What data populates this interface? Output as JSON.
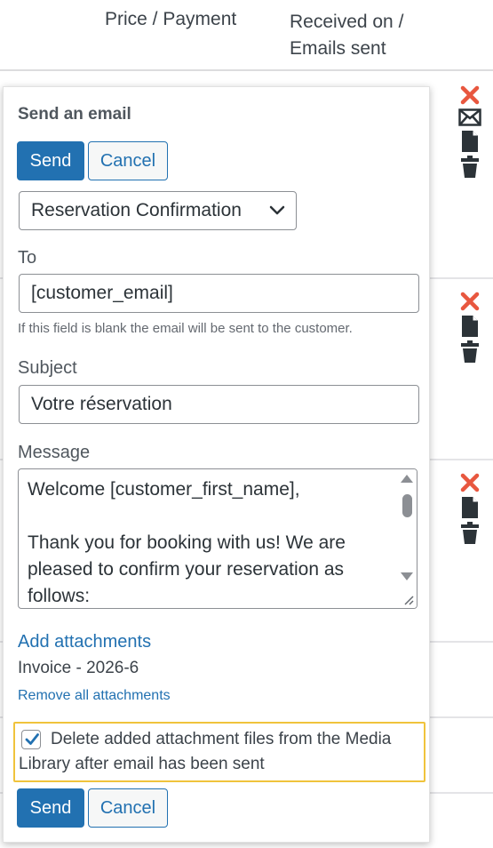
{
  "table": {
    "col_price": "Price / Payment",
    "col_received": "Received on / Emails sent"
  },
  "popup": {
    "title": "Send an email",
    "send_label": "Send",
    "cancel_label": "Cancel",
    "template_selected": "Reservation Confirmation",
    "to_label": "To",
    "to_value": "[customer_email]",
    "to_help": "If this field is blank the email will be sent to the customer.",
    "subject_label": "Subject",
    "subject_value": "Votre réservation",
    "message_label": "Message",
    "message_value": "Welcome [customer_first_name],\n\nThank you for booking with us! We are pleased to confirm your reservation as follows:",
    "add_attachments": "Add attachments",
    "attachment_name": "Invoice - 2026-6",
    "remove_attachments": "Remove all attachments",
    "delete_checkbox_label": "Delete added attachment files from the Media Library after email has been sent",
    "delete_checkbox_checked": true
  },
  "colors": {
    "primary": "#2271b1",
    "delete_red": "#e8573f",
    "highlight": "#f0c33c",
    "icon_dark": "#2c3338"
  },
  "icons": [
    "close-icon",
    "email-icon",
    "document-icon",
    "trash-icon",
    "chevron-down-icon",
    "checkmark-icon"
  ]
}
